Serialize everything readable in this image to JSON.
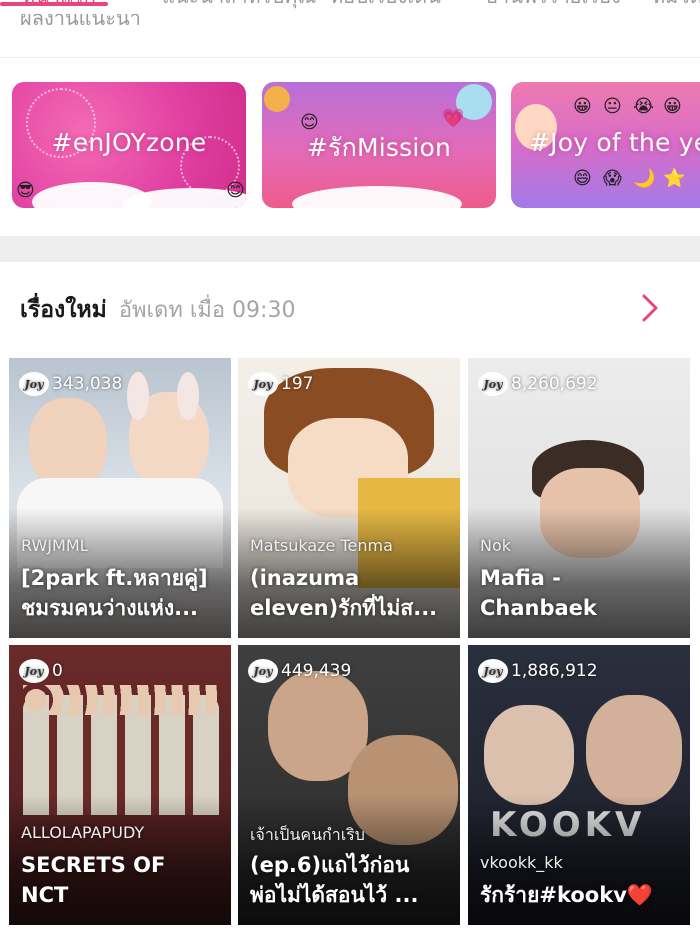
{
  "tabs": [
    {
      "label": "หน้าแรก",
      "active": true
    },
    {
      "label": "แนะนำสำหรับคุณ",
      "active": false
    },
    {
      "label": "ท็อปเรื่องเด่น",
      "active": false
    },
    {
      "label": "อ่านฟรีรายเรื่อง",
      "active": false
    },
    {
      "label": "หมวด",
      "active": false
    }
  ],
  "tab_subtext": "ผลงานแนะนำ",
  "banners": [
    {
      "label": "#enJOYzone"
    },
    {
      "label": "#รักMission"
    },
    {
      "label": "#Joy of the year"
    }
  ],
  "section": {
    "title": "เรื่องใหม่",
    "updated": "อัพเดท เมื่อ 09:30"
  },
  "cards": [
    {
      "views": "343,038",
      "author": "RWJMML",
      "title_line1": "[2park ft.หลายคู่]",
      "title_line2": "ชมรมคนว่างแห่ง..."
    },
    {
      "views": "197",
      "author": "Matsukaze Tenma",
      "title_line1": "(inazuma",
      "title_line2": "eleven)รักที่ไม่ส..."
    },
    {
      "views": "8,260,692",
      "author": "Nok",
      "title_line1": "Mafia -",
      "title_line2": "Chanbaek"
    },
    {
      "views": "0",
      "author": "ALLOLAPAPUDY",
      "title_line1": "SECRETS OF",
      "title_line2": "NCT"
    },
    {
      "views": "449,439",
      "author": "เจ้าเป็นคนกำเริบ",
      "title_line1": "(ep.6)แถไว้ก่อน",
      "title_line2": "พ่อไม่ได้สอนไว้ ..."
    },
    {
      "views": "1,886,912",
      "author": "vkookk_kk",
      "title_line1": "รักร้าย#kookv❤️",
      "title_line2": ""
    }
  ],
  "joy_badge": "Joy",
  "colors": {
    "accent": "#e8457a",
    "muted": "#a5a5a5",
    "band": "#eeeeee"
  }
}
